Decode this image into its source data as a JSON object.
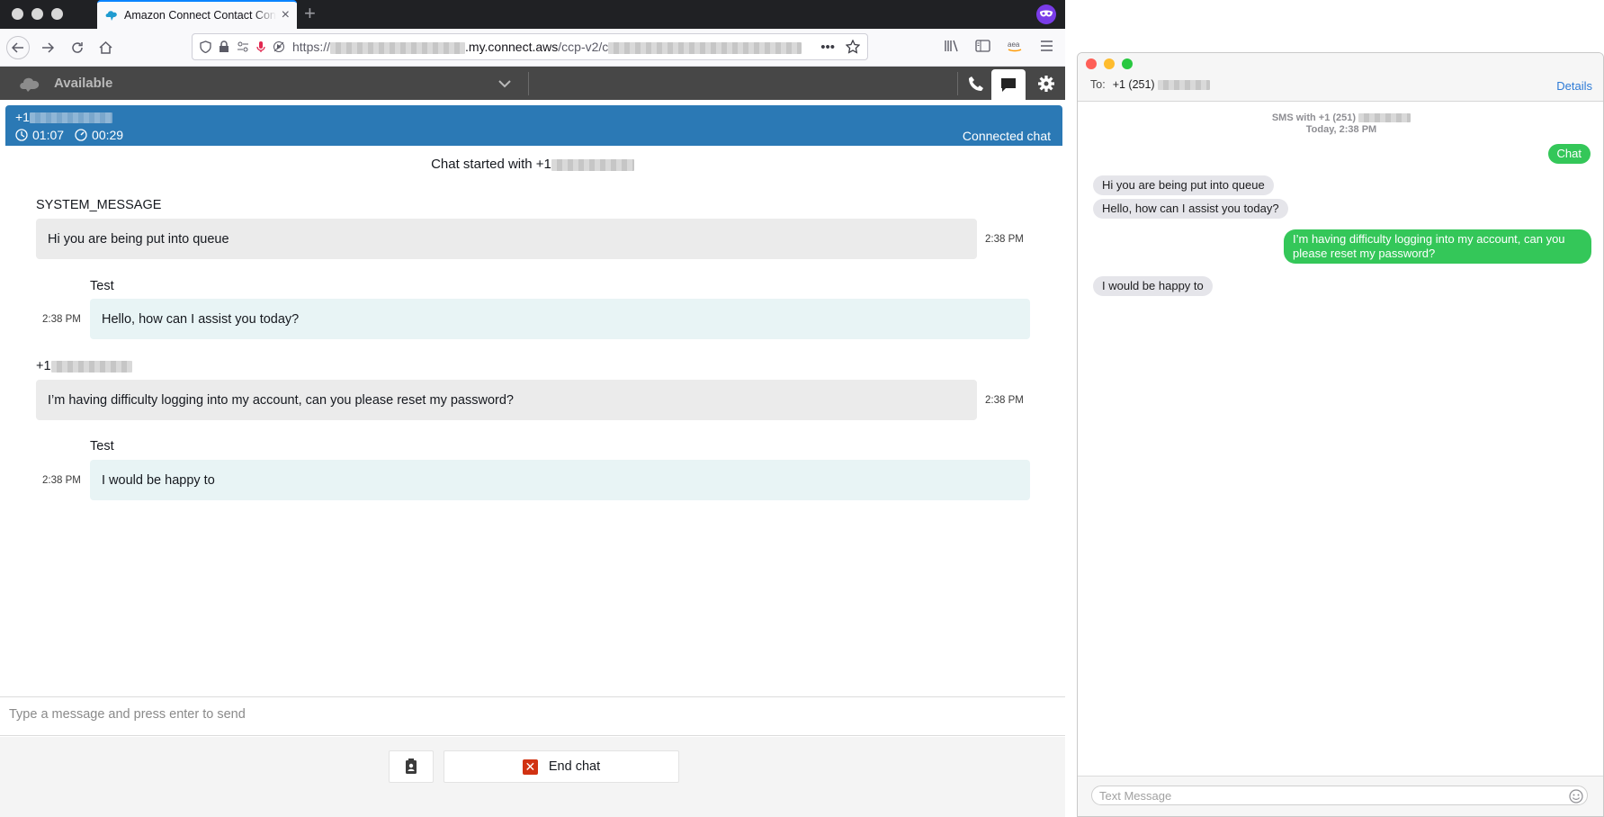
{
  "browser": {
    "tab_title": "Amazon Connect Contact Control Panel",
    "new_tab_glyph": "+",
    "close_glyph": "×",
    "url_scheme": "https://",
    "url_host": ".my.connect.aws",
    "url_path": "/ccp-v2/c",
    "url_overflow": "•••"
  },
  "ccp": {
    "agent_status": "Available",
    "contact": {
      "number_prefix": "+1",
      "elapsed": "01:07",
      "wait": "00:29",
      "state": "Connected chat"
    },
    "chat_started": "Chat started with  +1",
    "messages": [
      {
        "sender": "SYSTEM_MESSAGE",
        "text": "Hi you are being put into queue",
        "time": "2:38 PM",
        "side": "customer"
      },
      {
        "sender": "Test",
        "text": "Hello, how can I assist you today?",
        "time": "2:38 PM",
        "side": "agent"
      },
      {
        "sender": "+1",
        "text": "I’m having difficulty logging into my account, can you please reset my password?",
        "time": "2:38 PM",
        "side": "customer"
      },
      {
        "sender": "Test",
        "text": "I would be happy to",
        "time": "2:38 PM",
        "side": "agent"
      }
    ],
    "composer_placeholder": "Type a message and press enter to send",
    "end_chat_label": "End chat",
    "end_chat_glyph": "✕"
  },
  "messages_app": {
    "to_label": "To:",
    "to_number": "+1 (251)",
    "details_label": "Details",
    "header_line1": "SMS with +1 (251)",
    "header_line2": "Today, 2:38 PM",
    "bubbles": [
      {
        "text": "Chat",
        "dir": "out"
      },
      {
        "text": "Hi you are being put into queue",
        "dir": "in"
      },
      {
        "text": "Hello, how can I assist you today?",
        "dir": "in"
      },
      {
        "text": "I’m having difficulty logging into my account, can you please reset my password?",
        "dir": "out"
      },
      {
        "text": "I would be happy to",
        "dir": "in"
      }
    ],
    "input_placeholder": "Text Message"
  },
  "colors": {
    "ccp_topbar": "#474747",
    "contact_bar": "#2b79b5",
    "end_chat_icon": "#d13212",
    "imessage_green": "#34c759",
    "incoming_gray": "#e5e5ea"
  },
  "icons": [
    "back-icon",
    "forward-icon",
    "reload-icon",
    "home-icon",
    "shield-icon",
    "lock-icon",
    "microphone-icon",
    "star-icon",
    "library-icon",
    "sidebar-icon",
    "amazon-icon",
    "menu-icon",
    "cloud-icon",
    "chevron-down-icon",
    "phone-icon",
    "chat-icon",
    "gear-icon",
    "clock-icon",
    "timer-icon",
    "quick-connect-icon",
    "emoji-icon"
  ]
}
